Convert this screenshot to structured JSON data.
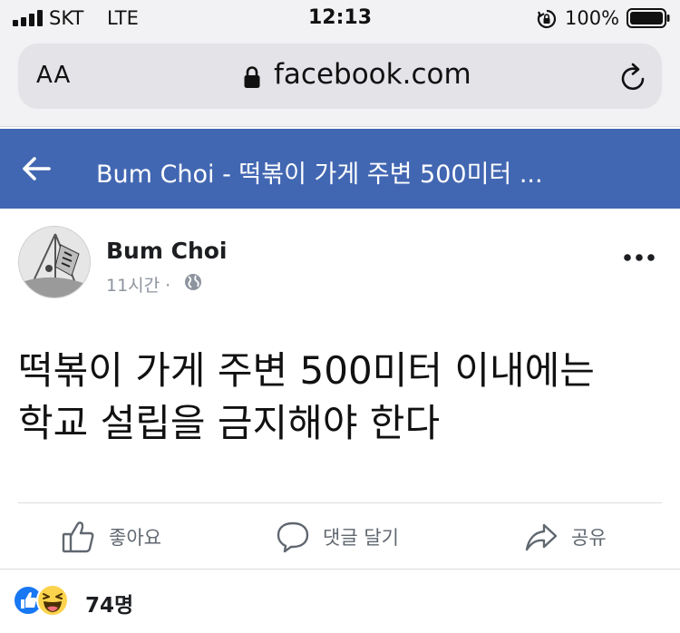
{
  "status_bar": {
    "carrier": "SKT",
    "network": "LTE",
    "time": "12:13",
    "battery": "100%"
  },
  "browser": {
    "text_size_label": "AA",
    "url": "facebook.com"
  },
  "header": {
    "title": "Bum Choi - 떡볶이 가게 주변 500미터 ...",
    "color": "#4267b2"
  },
  "post": {
    "author": "Bum Choi",
    "time": "11시간 ·",
    "text_line1": "떡볶이 가게 주변 500미터 이내에는",
    "text_line2": "학교 설립을 금지해야 한다"
  },
  "actions": {
    "like": "좋아요",
    "comment": "댓글 달기",
    "share": "공유"
  },
  "reactions": {
    "count": "74명",
    "icons": [
      "like-icon",
      "haha-icon"
    ]
  }
}
